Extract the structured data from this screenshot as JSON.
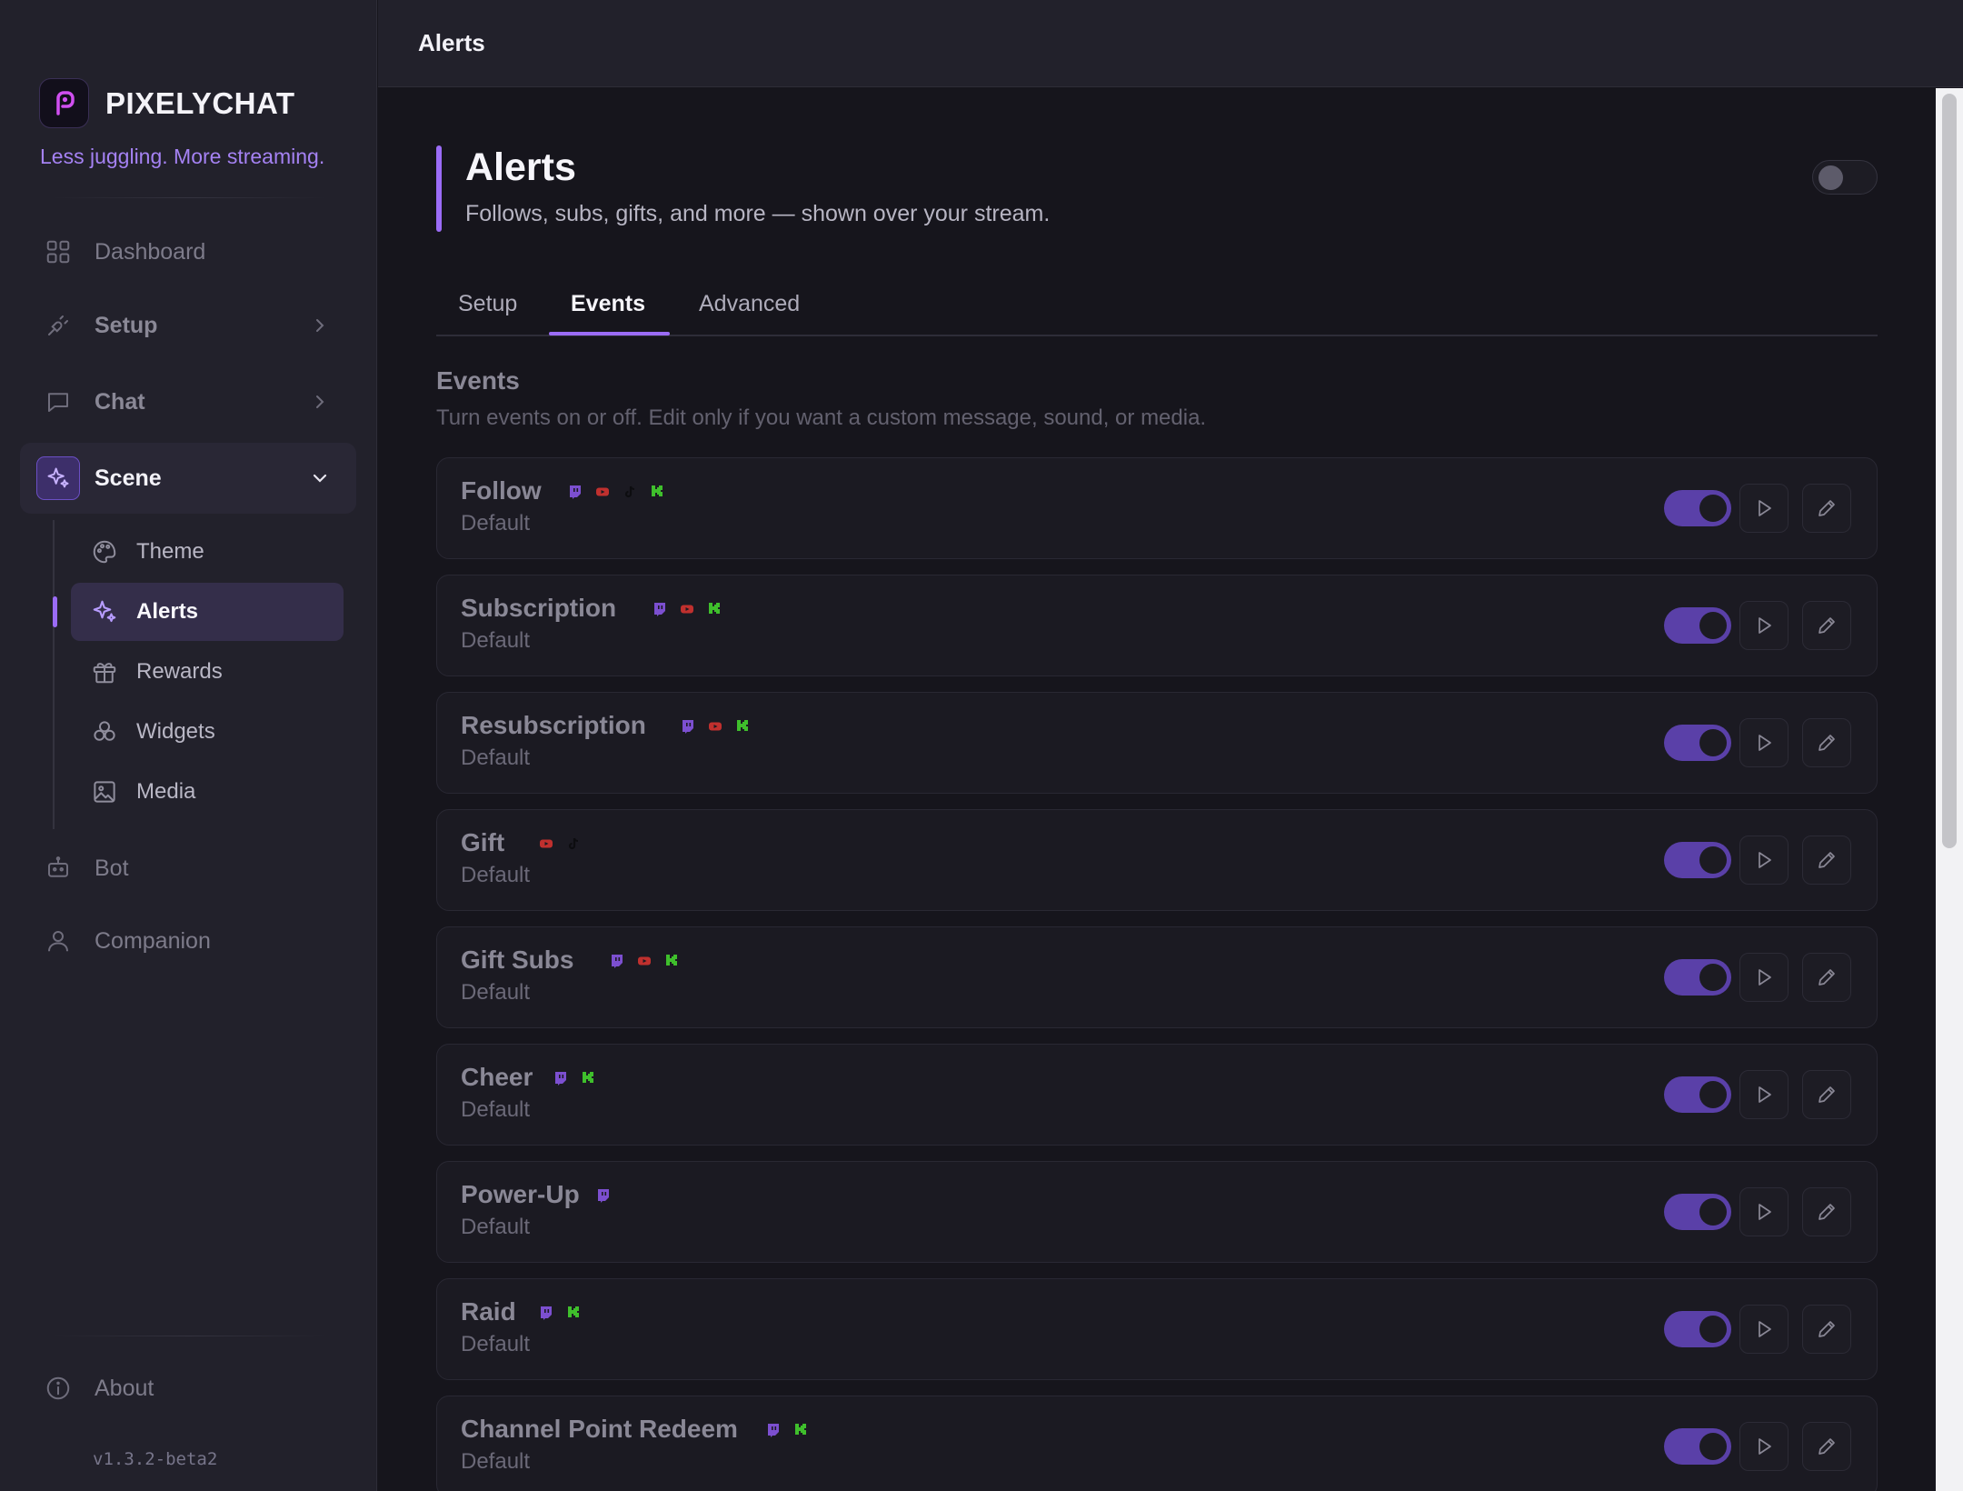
{
  "brand": {
    "name": "PIXELYCHAT",
    "tagline": "Less juggling. More streaming."
  },
  "sidebar": {
    "items": [
      {
        "label": "Dashboard",
        "icon": "grid-icon"
      },
      {
        "label": "Setup",
        "icon": "plug-icon"
      },
      {
        "label": "Chat",
        "icon": "chat-bubble-icon"
      },
      {
        "label": "Scene",
        "icon": "sparkles-icon"
      },
      {
        "label": "Bot",
        "icon": "robot-icon"
      },
      {
        "label": "Companion",
        "icon": "user-icon"
      }
    ],
    "scene_children": [
      {
        "label": "Theme",
        "icon": "palette-icon"
      },
      {
        "label": "Alerts",
        "icon": "sparkles-icon"
      },
      {
        "label": "Rewards",
        "icon": "gift-icon"
      },
      {
        "label": "Widgets",
        "icon": "widgets-icon"
      },
      {
        "label": "Media",
        "icon": "image-icon"
      }
    ],
    "about": "About",
    "version": "v1.3.2-beta2"
  },
  "topbar": {
    "title": "Alerts"
  },
  "page": {
    "title": "Alerts",
    "subtitle": "Follows, subs, gifts, and more — shown over your stream.",
    "enabled": false
  },
  "tabs": [
    {
      "label": "Setup"
    },
    {
      "label": "Events"
    },
    {
      "label": "Advanced"
    }
  ],
  "active_tab": "Events",
  "section": {
    "title": "Events",
    "description": "Turn events on or off. Edit only if you want a custom message, sound, or media."
  },
  "colors": {
    "accent": "#9b6cf6",
    "twitch": "#7c4fd0",
    "youtube": "#c0302e",
    "tiktok": "#111111",
    "kick": "#3fbf2c"
  },
  "events": [
    {
      "name": "Follow",
      "subtitle": "Default",
      "platforms": [
        "twitch",
        "youtube",
        "tiktok",
        "kick"
      ],
      "enabled": true
    },
    {
      "name": "Subscription",
      "subtitle": "Default",
      "platforms": [
        "twitch",
        "youtube",
        "kick"
      ],
      "enabled": true
    },
    {
      "name": "Resubscription",
      "subtitle": "Default",
      "platforms": [
        "twitch",
        "youtube",
        "kick"
      ],
      "enabled": true
    },
    {
      "name": "Gift",
      "subtitle": "Default",
      "platforms": [
        "youtube",
        "tiktok"
      ],
      "enabled": true
    },
    {
      "name": "Gift Subs",
      "subtitle": "Default",
      "platforms": [
        "twitch",
        "youtube",
        "kick"
      ],
      "enabled": true
    },
    {
      "name": "Cheer",
      "subtitle": "Default",
      "platforms": [
        "twitch",
        "kick"
      ],
      "enabled": true
    },
    {
      "name": "Power-Up",
      "subtitle": "Default",
      "platforms": [
        "twitch"
      ],
      "enabled": true
    },
    {
      "name": "Raid",
      "subtitle": "Default",
      "platforms": [
        "twitch",
        "kick"
      ],
      "enabled": true
    },
    {
      "name": "Channel Point Redeem",
      "subtitle": "Default",
      "platforms": [
        "twitch",
        "kick"
      ],
      "enabled": true
    }
  ]
}
